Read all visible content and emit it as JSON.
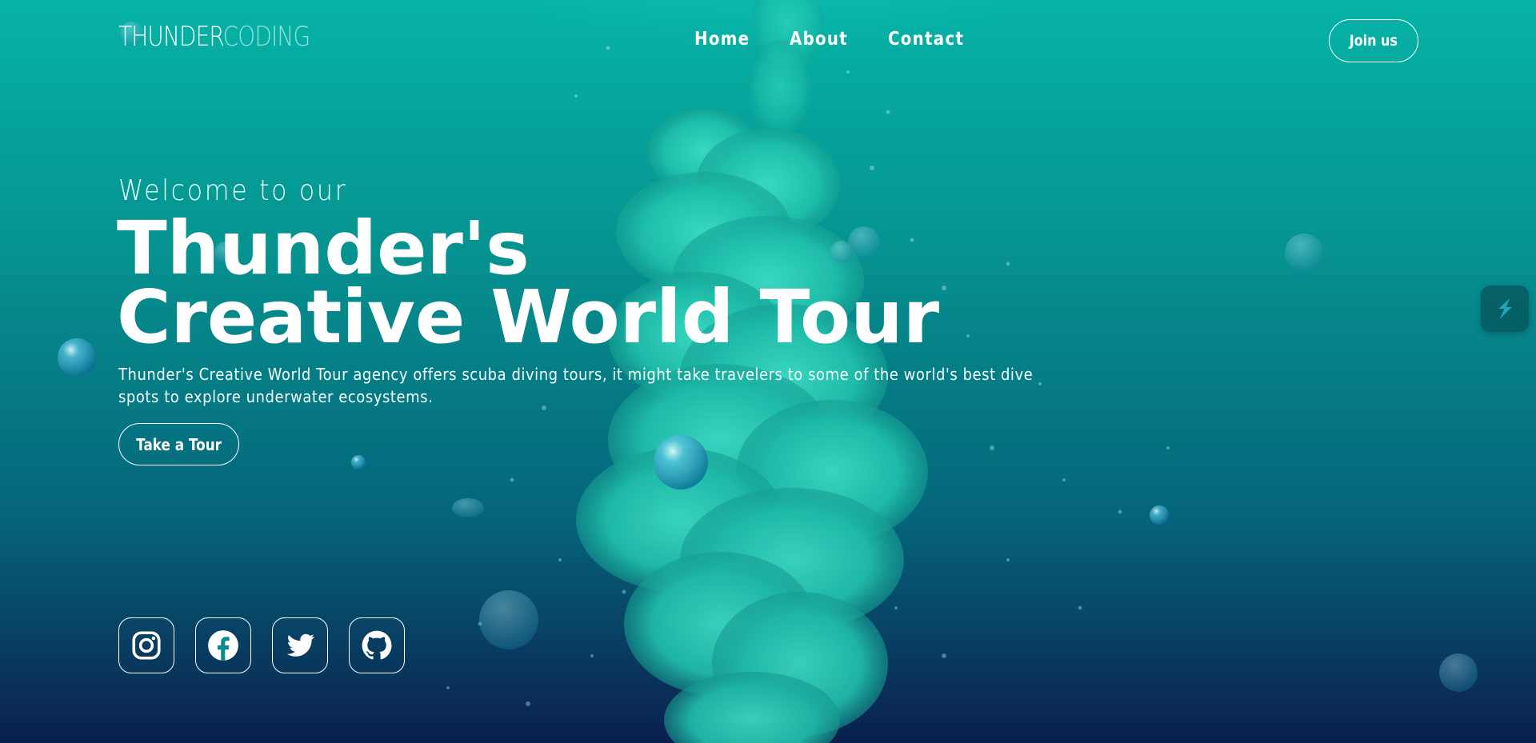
{
  "brand": {
    "logo_part1": "THUNDER",
    "logo_part2": "CODING"
  },
  "nav": {
    "items": [
      "Home",
      "About",
      "Contact"
    ]
  },
  "header": {
    "join_label": "Join us"
  },
  "hero": {
    "welcome": "Welcome to our",
    "title_line1": "Thunder's",
    "title_line2": "Creative World Tour",
    "description": "Thunder's Creative World Tour agency offers scuba diving tours, it might take travelers to some of the world's best dive spots to explore underwater ecosystems.",
    "cta_label": "Take a Tour"
  },
  "socials": {
    "icons": [
      "instagram-icon",
      "facebook-icon",
      "twitter-icon",
      "github-icon"
    ]
  },
  "side_widget": {
    "icon": "lightning-icon"
  },
  "colors": {
    "background_top": "#06b3a6",
    "background_bottom": "#0b1f4e",
    "text": "#ffffff",
    "logo_accent": "#8fe3dc"
  }
}
